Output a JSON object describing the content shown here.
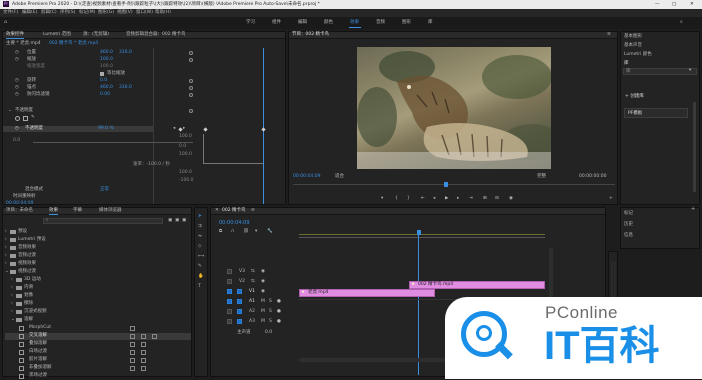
{
  "titlebar": {
    "text": "Adobe Premiere Pro 2020 - D:\\(走查)视频素材\\查看手-附)\\跟踪粒子\\(大)\\跟踪特效\\(2)\\项目\\(横版) \\Adobe Premiere Pro Auto-Save\\未命名.prproj *",
    "minimize": "—",
    "maximize": "□",
    "close": "✕"
  },
  "menu": [
    "文件(F)",
    "编辑(E)",
    "剪辑(C)",
    "序列(S)",
    "标记(M)",
    "图形(G)",
    "视图(V)",
    "窗口(W)",
    "帮助(H)"
  ],
  "workspaces": [
    "学习",
    "组件",
    "编辑",
    "颜色",
    "效果",
    "音频",
    "图形",
    "库"
  ],
  "active_workspace": "效果",
  "effect_controls": {
    "tabs": [
      "效果控件",
      "Lumetri 范围",
      "源：(无剪辑)",
      "音频剪辑混合器：002 精卡鸟"
    ],
    "source_line": "主要 * 老虎.mp4",
    "seq_line": "002 精卡鸟 * 老虎.mp4",
    "rows": [
      {
        "label": "位置",
        "v1": "460.0",
        "v2": "316.0"
      },
      {
        "label": "缩放",
        "v1": "100.0",
        "v2": ""
      },
      {
        "label": "缩放宽度",
        "v1": "100.0",
        "v2": ""
      },
      {
        "label": "等比缩放",
        "v1": "",
        "v2": ""
      },
      {
        "label": "旋转",
        "v1": "0.0",
        "v2": ""
      },
      {
        "label": "锚点",
        "v1": "460.0",
        "v2": "316.0"
      },
      {
        "label": "防闪烁滤镜",
        "v1": "0.00",
        "v2": ""
      },
      {
        "label": "不透明度",
        "v1": "",
        "v2": ""
      },
      {
        "label": "不透明度",
        "v1": "99.0 %",
        "v2": ""
      }
    ],
    "graph_top": "100.0",
    "graph_bottom": "0.0",
    "graph_top2": "100.0",
    "graph_bottom2": "0.0",
    "speed_label": "速率：-100.0 / 秒",
    "speed_top": "100.0",
    "speed_bottom": "-100.0",
    "blend_label": "混合模式",
    "blend_value": "正常",
    "time_remap": "时间重映射",
    "timecode": "00:00:04:09"
  },
  "program_monitor": {
    "title": "节目：002 精卡鸟",
    "timecode_left": "00:00:04:09",
    "fit": "适合",
    "quality": "完整",
    "timecode_right": "00:00:00:00"
  },
  "right_panels": {
    "items_top": [
      "基本图形",
      "基本声音",
      "Lumetri 颜色",
      "库"
    ],
    "lib_placeholder": "库",
    "create_label": "+ 创建库",
    "search_label": "PF模板",
    "items_bottom": [
      "标记",
      "历史",
      "信息"
    ]
  },
  "project_panel": {
    "tabs": [
      "项目：未命名",
      "效果",
      "字幕",
      "媒体浏览器"
    ],
    "tree": [
      "预设",
      "Lumetri 预设",
      "音频效果",
      "音频过渡",
      "视频效果",
      "视频过渡",
      "3D 运动",
      "内滑",
      "划像",
      "擦除",
      "沉浸式视频",
      "溶解",
      "MorphCut",
      "交叉溶解",
      "叠加溶解",
      "白场过渡",
      "胶片溶解",
      "非叠加溶解",
      "黑场过渡"
    ]
  },
  "timeline": {
    "title": "002 精卡鸟",
    "timecode": "00:00:04:09",
    "tracks": [
      "V3",
      "V2",
      "V1",
      "A1",
      "A2",
      "A3"
    ],
    "clip_upper": "002 精卡鸟.mp4",
    "clip_lower": "老虎.mp4",
    "master_label": "主声道",
    "master_value": "0.0"
  },
  "watermark": {
    "brand_small": "PConline",
    "brand_big": "IT百科"
  }
}
